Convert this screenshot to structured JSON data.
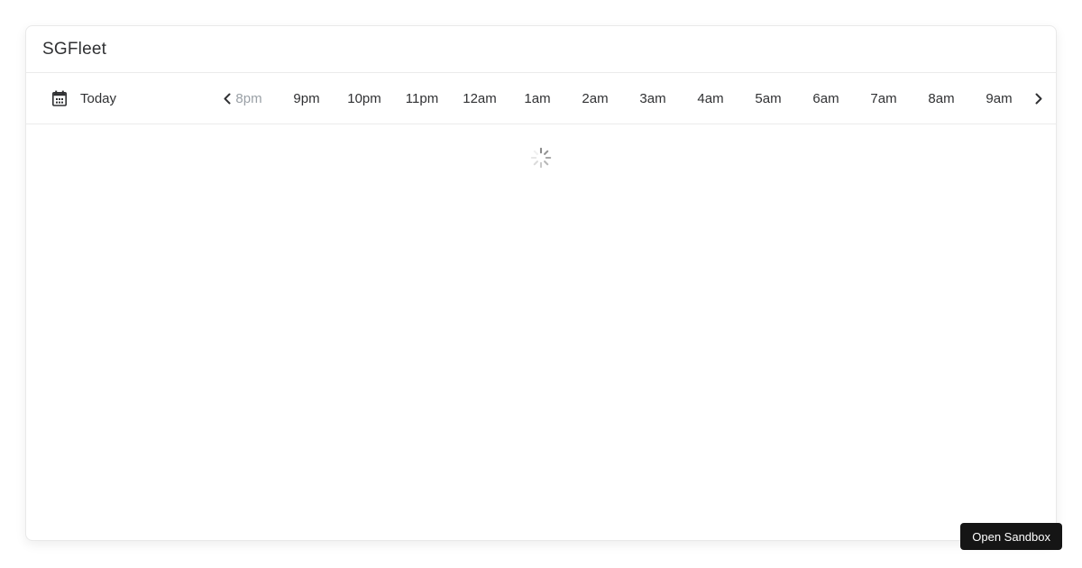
{
  "card": {
    "title": "SGFleet"
  },
  "toolbar": {
    "today": {
      "label": "Today",
      "icon": "calendar-icon"
    },
    "prev_icon": "chevron-left-icon",
    "next_icon": "chevron-right-icon",
    "time_labels": [
      {
        "label": "8pm",
        "muted": true
      },
      {
        "label": "9pm",
        "muted": false
      },
      {
        "label": "10pm",
        "muted": false
      },
      {
        "label": "11pm",
        "muted": false
      },
      {
        "label": "12am",
        "muted": false
      },
      {
        "label": "1am",
        "muted": false
      },
      {
        "label": "2am",
        "muted": false
      },
      {
        "label": "3am",
        "muted": false
      },
      {
        "label": "4am",
        "muted": false
      },
      {
        "label": "5am",
        "muted": false
      },
      {
        "label": "6am",
        "muted": false
      },
      {
        "label": "7am",
        "muted": false
      },
      {
        "label": "8am",
        "muted": false
      },
      {
        "label": "9am",
        "muted": false
      }
    ]
  },
  "content": {
    "state": "loading",
    "spinner_icon": "spinner-icon"
  },
  "sandbox_button": {
    "label": "Open Sandbox"
  },
  "colors": {
    "card_border": "#e9e9e9",
    "divider": "#ebebeb",
    "text_primary": "#303133",
    "text_muted": "#9aa0a6",
    "spinner": "#8a8a8a",
    "button_bg": "#151515",
    "button_text": "#ffffff"
  }
}
